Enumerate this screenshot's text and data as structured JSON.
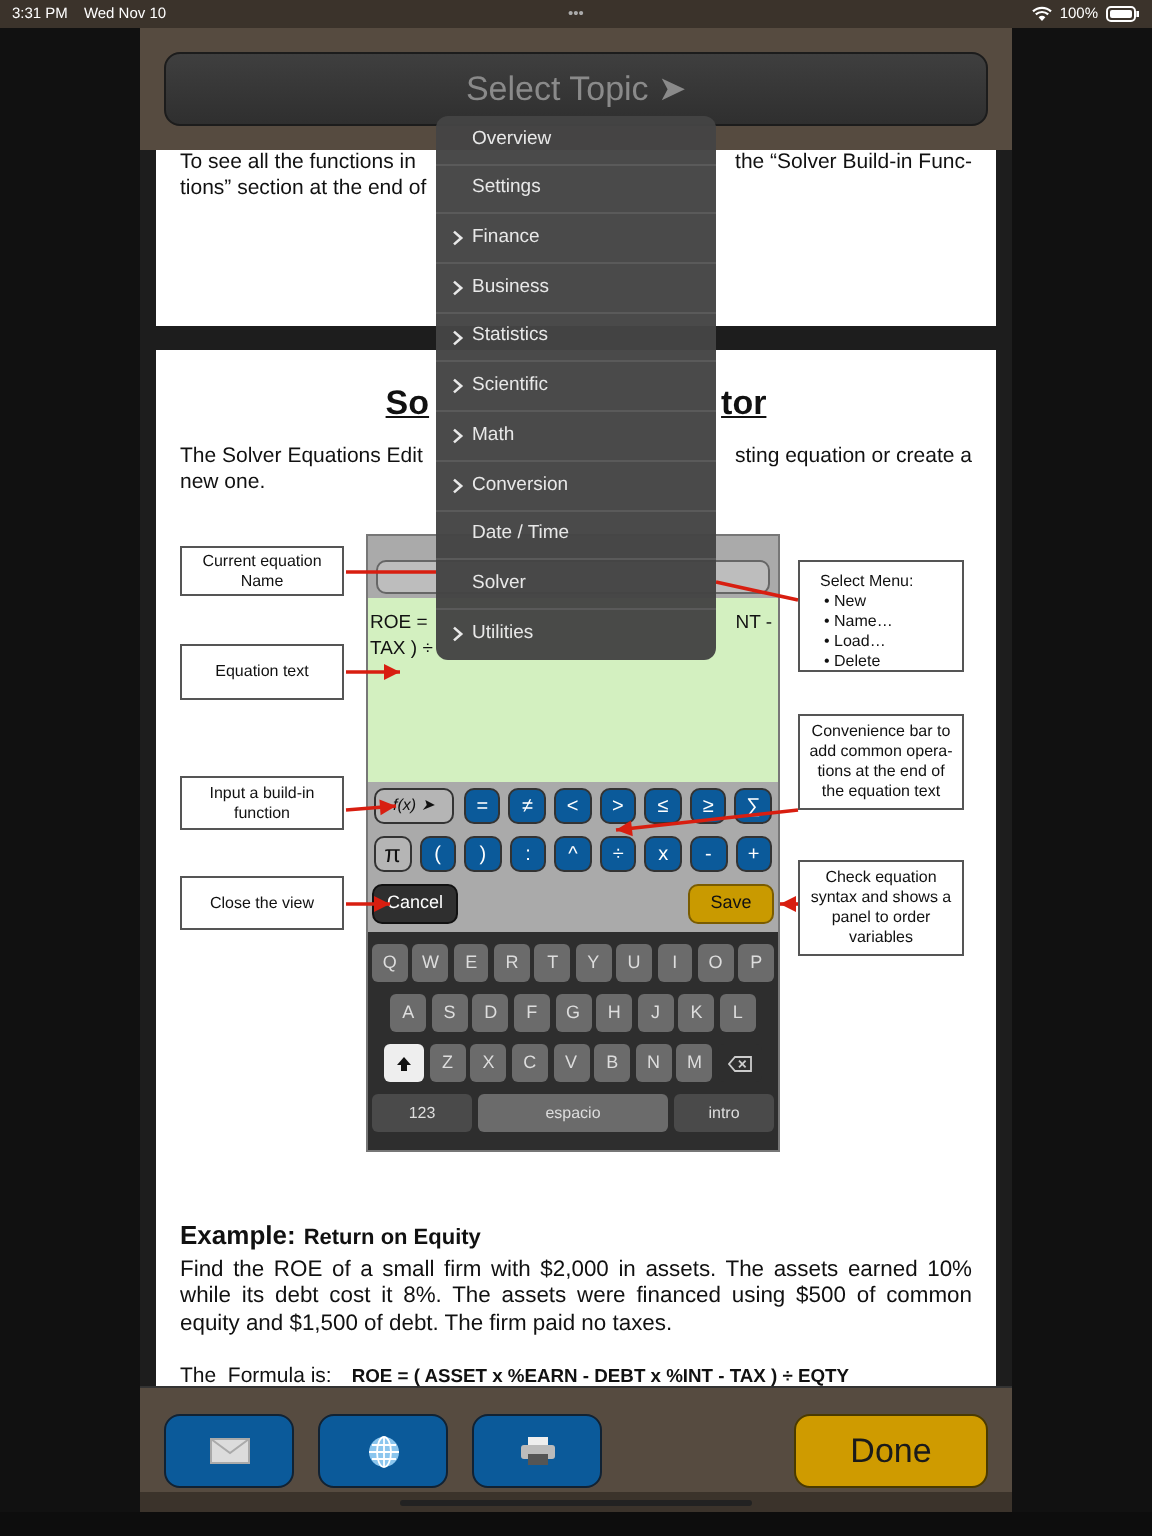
{
  "status_bar": {
    "time": "3:31 PM",
    "date": "Wed Nov 10",
    "dots": "•••",
    "battery": "100%"
  },
  "header": {
    "topic_button": "Select Topic ➤"
  },
  "topic_menu": [
    {
      "label": "Overview",
      "submenu": false
    },
    {
      "label": "Settings",
      "submenu": false
    },
    {
      "label": "Finance",
      "submenu": true
    },
    {
      "label": "Business",
      "submenu": true
    },
    {
      "label": "Statistics",
      "submenu": true
    },
    {
      "label": "Scientific",
      "submenu": true
    },
    {
      "label": "Math",
      "submenu": true
    },
    {
      "label": "Conversion",
      "submenu": true
    },
    {
      "label": "Date / Time",
      "submenu": false
    },
    {
      "label": "Solver",
      "submenu": false
    },
    {
      "label": "Utilities",
      "submenu": true
    }
  ],
  "page_1": {
    "lines": [
      {
        "left": "To see all the functions in",
        "right": "the “Solver Build-in Func-"
      },
      {
        "left": "tions” section at the end of"
      }
    ]
  },
  "page_2": {
    "title_parts": [
      "So",
      "tor"
    ],
    "lead_lines": [
      {
        "left": "The Solver Equations Edit",
        "right": "sting equation or create a"
      },
      {
        "left": "new one."
      }
    ],
    "diagram": {
      "callouts_left": [
        "Current equation Name",
        "Equation text",
        "Input a build-in function",
        "Close the view"
      ],
      "select_menu": {
        "heading": "Select Menu:",
        "items": [
          "• New",
          "• Name…",
          "• Load…",
          "• Delete"
        ]
      },
      "callouts_right": [
        "Convenience bar to add common opera-tions at the end of the equation text",
        "Check equation syntax and shows a panel to order variables"
      ],
      "editor": {
        "equation_lines": [
          {
            "left": "ROE =",
            "right": "NT -"
          },
          {
            "left": "TAX ) ÷"
          }
        ],
        "function_key": "f(x) ➤",
        "keys": [
          [
            {
              "label": "=",
              "kind": "blue"
            },
            {
              "label": "≠",
              "kind": "blue"
            },
            {
              "label": "<",
              "kind": "blue"
            },
            {
              "label": ">",
              "kind": "blue"
            },
            {
              "label": "≤",
              "kind": "blue"
            },
            {
              "label": "≥",
              "kind": "blue"
            },
            {
              "label": "∑",
              "kind": "blue"
            }
          ],
          [
            {
              "label": "π",
              "kind": "gray"
            },
            {
              "label": "(",
              "kind": "blue"
            },
            {
              "label": ")",
              "kind": "blue"
            },
            {
              "label": ":",
              "kind": "blue"
            },
            {
              "label": "^",
              "kind": "blue"
            },
            {
              "label": "÷",
              "kind": "blue"
            },
            {
              "label": "x",
              "kind": "blue"
            },
            {
              "label": "-",
              "kind": "blue"
            },
            {
              "label": "+",
              "kind": "blue"
            }
          ]
        ],
        "cancel": "Cancel",
        "save": "Save",
        "keyboard": [
          [
            {
              "label": "Q",
              "kind": "letter"
            },
            {
              "label": "W",
              "kind": "letter"
            },
            {
              "label": "E",
              "kind": "letter"
            },
            {
              "label": "R",
              "kind": "letter"
            },
            {
              "label": "T",
              "kind": "letter"
            },
            {
              "label": "Y",
              "kind": "letter"
            },
            {
              "label": "U",
              "kind": "letter"
            },
            {
              "label": "I",
              "kind": "letter"
            },
            {
              "label": "O",
              "kind": "letter"
            },
            {
              "label": "P",
              "kind": "letter"
            }
          ],
          [
            {
              "label": "A",
              "kind": "letter"
            },
            {
              "label": "S",
              "kind": "letter"
            },
            {
              "label": "D",
              "kind": "letter"
            },
            {
              "label": "F",
              "kind": "letter"
            },
            {
              "label": "G",
              "kind": "letter"
            },
            {
              "label": "H",
              "kind": "letter"
            },
            {
              "label": "J",
              "kind": "letter"
            },
            {
              "label": "K",
              "kind": "letter"
            },
            {
              "label": "L",
              "kind": "letter"
            }
          ],
          [
            {
              "kind": "shift"
            },
            {
              "label": "Z",
              "kind": "letter"
            },
            {
              "label": "X",
              "kind": "letter"
            },
            {
              "label": "C",
              "kind": "letter"
            },
            {
              "label": "V",
              "kind": "letter"
            },
            {
              "label": "B",
              "kind": "letter"
            },
            {
              "label": "N",
              "kind": "letter"
            },
            {
              "label": "M",
              "kind": "letter"
            },
            {
              "kind": "backspace"
            }
          ],
          [
            {
              "label": "123",
              "kind": "mode"
            },
            {
              "label": "espacio",
              "kind": "space"
            },
            {
              "label": "intro",
              "kind": "return"
            }
          ]
        ]
      }
    },
    "example": {
      "heading": "Example:",
      "title": "Return on Equity",
      "body": "Find the ROE of a small firm with $2,000 in assets. The assets earned 10% while its debt cost it 8%. The assets were financed using $500 of common equity and $1,500 of debt. The firm paid no taxes.",
      "formula_label": "The  Formula is:",
      "formula": "ROE = ( ASSET x %EARN - DEBT x %INT - TAX ) ÷ EQTY"
    }
  },
  "toolbar": {
    "buttons": [
      {
        "kind": "mail"
      },
      {
        "kind": "web"
      },
      {
        "kind": "print"
      }
    ],
    "done": "Done"
  }
}
